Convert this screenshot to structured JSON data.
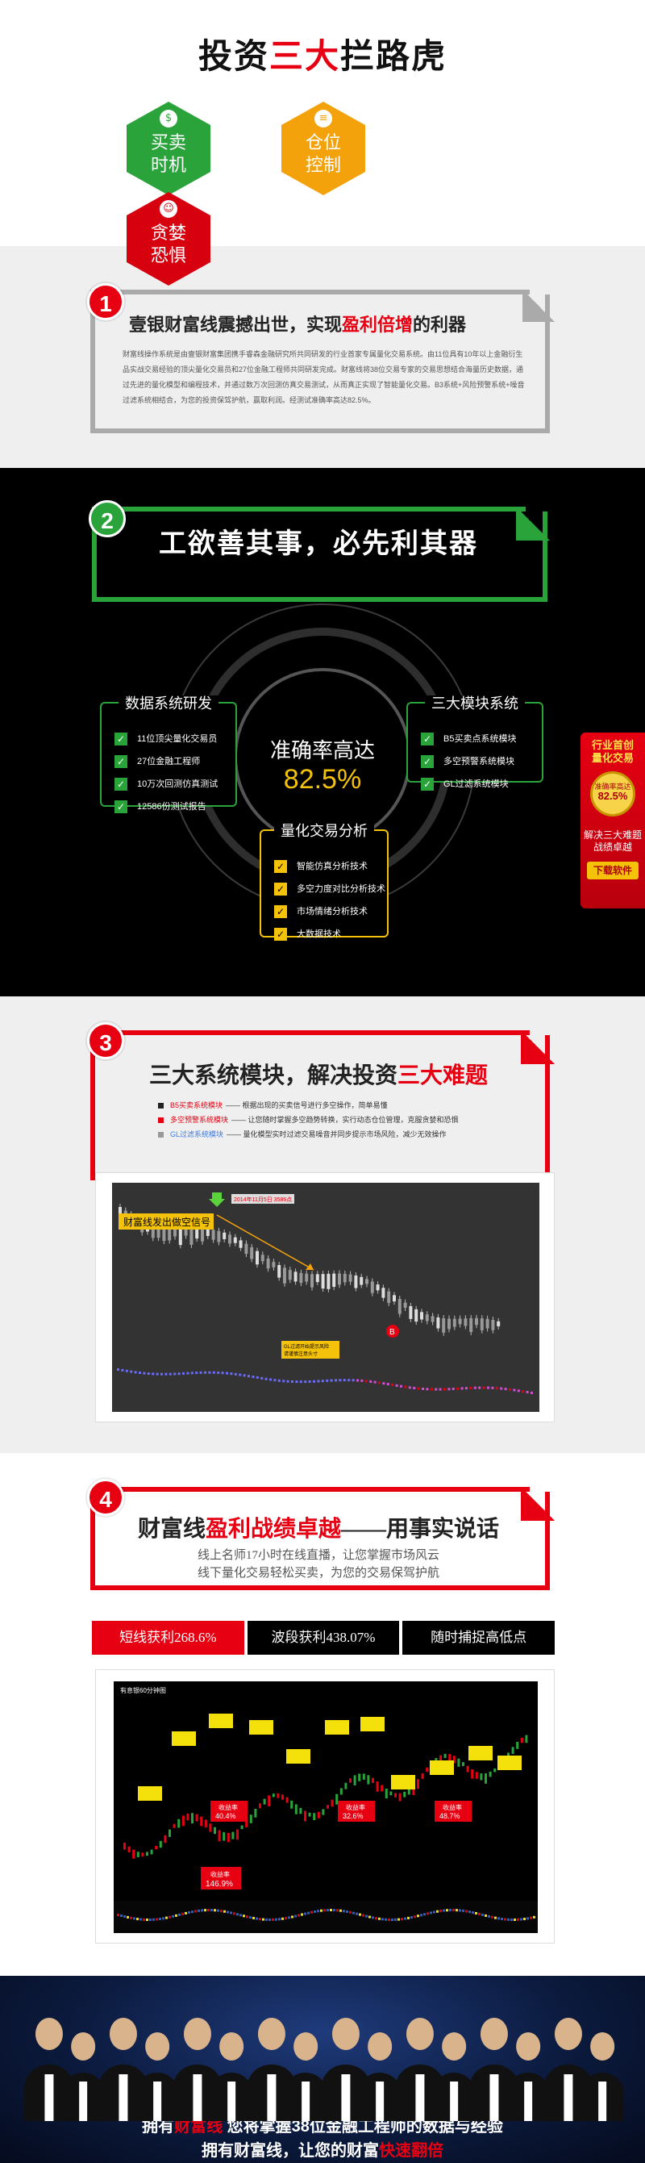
{
  "hero": {
    "title_pre": "投资",
    "title_red": "三大",
    "title_post": "拦路虎",
    "hex": [
      {
        "line1": "买卖",
        "line2": "时机",
        "icon": "money-bag-icon"
      },
      {
        "line1": "仓位",
        "line2": "控制",
        "icon": "coins-icon"
      },
      {
        "line1": "贪婪",
        "line2": "恐惧",
        "icon": "person-icon"
      }
    ]
  },
  "s1": {
    "badge": "1",
    "title_pre": "壹银财富线震撼出世，实现",
    "title_red": "盈利倍增",
    "title_post": "的利器",
    "body": "财富线操作系统是由壹银财富集团携手睿森金融研究所共同研发的行业首家专属量化交易系统。由11位具有10年以上金融衍生品实战交易经验的顶尖量化交易员和27位金融工程师共同研发完成。财富线将38位交易专家的交易思想结合海量历史数据，通过先进的量化模型和编程技术，并通过数万次回测仿真交易测试，从而真正实现了智能量化交易。B3系统+风险预警系统+噪音过滤系统相结合，为您的投资保驾护航，赢取利润。经测试准确率高达82.5%。"
  },
  "s2": {
    "badge": "2",
    "title": "工欲善其事，必先利其器",
    "center_line1": "准确率高达",
    "center_line2": "82.5%",
    "left_title": "数据系统研发",
    "left_items": [
      "11位顶尖量化交易员",
      "27位金融工程师",
      "10万次回测仿真测试",
      "12586份测试报告"
    ],
    "right_title": "三大模块系统",
    "right_items": [
      "B5买卖点系统模块",
      "多空预警系统模块",
      "GL过滤系统模块"
    ],
    "bottom_title": "量化交易分析",
    "bottom_items": [
      "智能仿真分析技术",
      "多空力度对比分析技术",
      "市场情绪分析技术",
      "大数据技术"
    ]
  },
  "side_ad": {
    "line1": "行业首创",
    "line2": "量化交易",
    "medal_top": "准确率高达",
    "medal_val": "82.5%",
    "line3": "解决三大难题",
    "line4": "战绩卓越",
    "download": "下载软件"
  },
  "s3": {
    "badge": "3",
    "title_pre": "三大系统模块，解决投资",
    "title_red": "三大难题",
    "items": [
      {
        "key": "B5买卖系统模块",
        "text": " —— 根据出现的买卖信号进行多空操作，简单易懂"
      },
      {
        "key": "多空预警系统模块",
        "text": " —— 让您随时掌握多空趋势转换，实行动态仓位管理，克服贪婪和恐惧"
      },
      {
        "key": "GL过滤系统模块",
        "text": " —— 量化模型实时过滤交易噪音并同步提示市场风险，减少无效操作"
      }
    ],
    "chart_label": "财富线发出做空信号",
    "chart_date": "2014年11月5日 3586点",
    "chart_note": "GL过滤开始提示风险\n请谨慎注意头寸",
    "chart_b": "B"
  },
  "s4": {
    "badge": "4",
    "title_pre": "财富线",
    "title_red": "盈利战绩卓越",
    "title_post": "——用事实说话",
    "sub1": "线上名师17小时在线直播，让您掌握市场风云",
    "sub2": "线下量化交易轻松买卖，为您的交易保驾护航",
    "tabs": [
      "短线获利268.6%",
      "波段获利438.07%",
      "随时捕捉高低点"
    ],
    "chart_head": "有息银60分钟图",
    "callouts": [
      "收益率\n40.4%",
      "收益率\n32.6%",
      "收益率\n48.7%",
      "收益率\n146.9%"
    ]
  },
  "footer": {
    "l1_pre": "拥有",
    "l1_red": "财富线",
    "l1_post": "   您将掌握38位金融工程师的数据与经验",
    "l2_pre": "拥有财富线，让您的财富",
    "l2_red": "快速翻倍"
  }
}
